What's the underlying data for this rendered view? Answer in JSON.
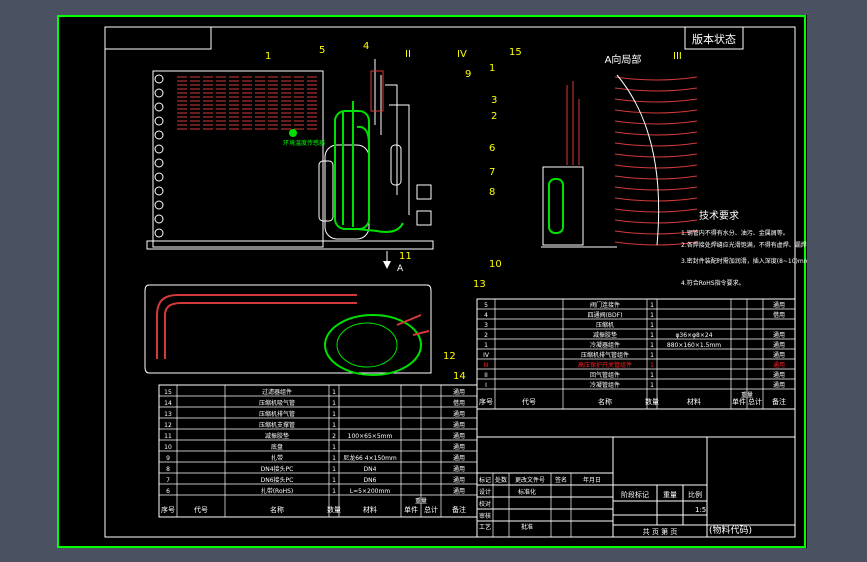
{
  "title_block": {
    "version_status": "版本状态",
    "view_a_label": "A向局部",
    "material_code": "(物料代码)",
    "scale_value": "1:5",
    "col_mark": "阶段标记",
    "col_weight": "重量",
    "col_scale": "比例",
    "sheets": "共   页   第   页",
    "rev_cells": [
      "标记",
      "处数",
      "更改文件号",
      "签名",
      "年月日"
    ],
    "sign_rows": [
      "设计",
      "标准化",
      "校对",
      "审核",
      "工艺",
      "批准"
    ]
  },
  "tech_requirements": {
    "title": "技术要求",
    "items": [
      "1.钢管内不得有水分、油污、金属屑等。",
      "2.各焊接处焊缝应光滑饱满，不得有虚焊、漏焊，焊缝等缺陷。",
      "3.密封件装配时需加润滑，插入深度(8~10)mm。",
      "4.符合RoHS指令要求。"
    ]
  },
  "callouts": [
    "1",
    "5",
    "4",
    "II",
    "IV",
    "9",
    "3",
    "2",
    "6",
    "7",
    "8",
    "10",
    "11",
    "15",
    "1",
    "III",
    "13",
    "12",
    "14"
  ],
  "section_arrow": "A",
  "note_label": "环境温度传感器",
  "upper_table": {
    "header": [
      "序号",
      "代号",
      "名称",
      "数量",
      "材料",
      "单件",
      "总计",
      "备注"
    ],
    "header_sub": "重量",
    "rows": [
      [
        "5",
        "",
        "阀门连接件",
        "1",
        "",
        "",
        "",
        "通用"
      ],
      [
        "4",
        "",
        "四通阀(BDF)",
        "1",
        "",
        "",
        "",
        "借用"
      ],
      [
        "3",
        "",
        "压缩机",
        "1",
        "",
        "",
        "",
        ""
      ],
      [
        "2",
        "",
        "减振胶垫",
        "1",
        "φ36×φ8×24",
        "",
        "",
        "通用"
      ],
      [
        "1",
        "",
        "冷凝器组件",
        "1",
        "880×160×1.5mm",
        "",
        "",
        "通用"
      ],
      [
        "IV",
        "",
        "压缩机排气管组件",
        "1",
        "",
        "",
        "",
        "通用"
      ],
      [
        "III",
        "",
        "高压保护开关管组件",
        "1",
        "",
        "",
        "",
        "通用"
      ],
      [
        "II",
        "",
        "回气管组件",
        "1",
        "",
        "",
        "",
        "通用"
      ],
      [
        "I",
        "",
        "冷凝管组件",
        "1",
        "",
        "",
        "",
        "通用"
      ]
    ]
  },
  "lower_table": {
    "header": [
      "序号",
      "代号",
      "名称",
      "数量",
      "材料",
      "单件",
      "总计",
      "备注"
    ],
    "header_sub": "重量",
    "rows": [
      [
        "15",
        "",
        "过滤器组件",
        "1",
        "",
        "",
        "",
        "通用"
      ],
      [
        "14",
        "",
        "压缩机吸气管",
        "1",
        "",
        "",
        "",
        "借用"
      ],
      [
        "13",
        "",
        "压缩机排气管",
        "1",
        "",
        "",
        "",
        "通用"
      ],
      [
        "12",
        "",
        "压缩机支撑管",
        "1",
        "",
        "",
        "",
        "通用"
      ],
      [
        "11",
        "",
        "减振胶垫",
        "2",
        "100×65×5mm",
        "",
        "",
        "通用"
      ],
      [
        "10",
        "",
        "底盘",
        "1",
        "",
        "",
        "",
        "通用"
      ],
      [
        "9",
        "",
        "扎带",
        "1",
        "尼龙66  4×150mm",
        "",
        "",
        "通用"
      ],
      [
        "8",
        "",
        "DN4接头PC",
        "1",
        "DN4",
        "",
        "",
        "通用"
      ],
      [
        "7",
        "",
        "DN6接头PC",
        "1",
        "DN6",
        "",
        "",
        "通用"
      ],
      [
        "6",
        "",
        "扎带(RoHS)",
        "1",
        "L=5×200mm",
        "",
        "",
        "通用"
      ]
    ]
  },
  "colors": {
    "frame": "#00ff00",
    "line": "#ffffff",
    "coil": "#d23a3a",
    "accent": "#ffff00",
    "highlight": "#ff2020",
    "part": "#00e000"
  }
}
